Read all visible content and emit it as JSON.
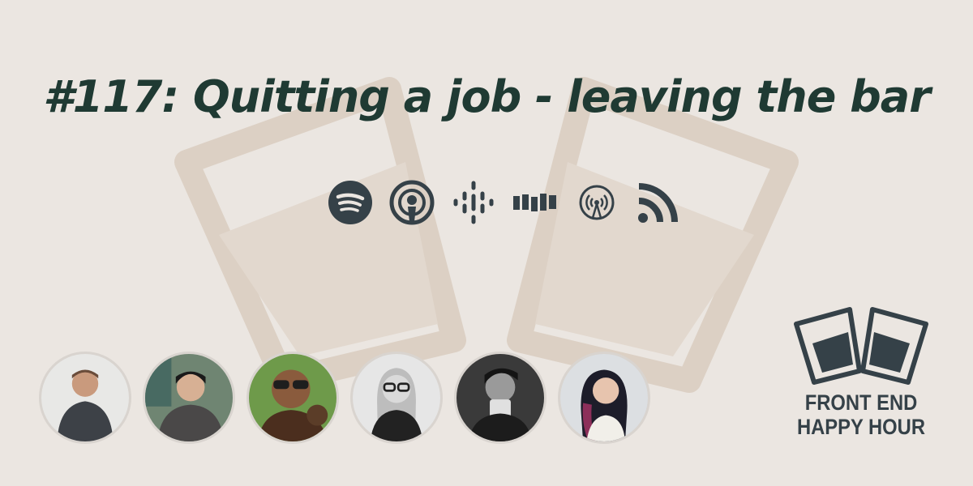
{
  "episode": {
    "title": "#117: Quitting a job - leaving the bar"
  },
  "listen_links": [
    {
      "icon": "spotify-icon"
    },
    {
      "icon": "apple-podcasts-icon"
    },
    {
      "icon": "google-podcasts-icon"
    },
    {
      "icon": "stitcher-icon"
    },
    {
      "icon": "overcast-icon"
    },
    {
      "icon": "rss-icon"
    }
  ],
  "hosts": [
    {
      "avatar": "avatar-1"
    },
    {
      "avatar": "avatar-2"
    },
    {
      "avatar": "avatar-3"
    },
    {
      "avatar": "avatar-4"
    },
    {
      "avatar": "avatar-5"
    },
    {
      "avatar": "avatar-6"
    }
  ],
  "brand": {
    "line1": "FRONT END",
    "line2": "HAPPY HOUR"
  },
  "colors": {
    "background": "#ebe6e1",
    "title": "#1f3a33",
    "icons": "#354148",
    "watermark": "#dcd0c4"
  }
}
